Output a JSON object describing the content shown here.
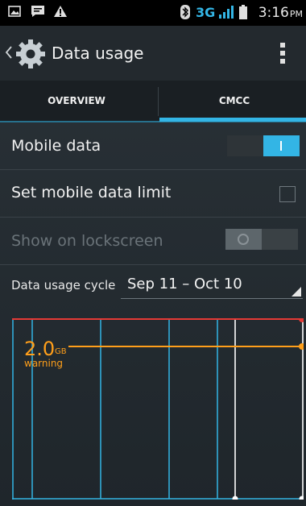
{
  "statusbar": {
    "left_icons": [
      "gallery-icon",
      "message-icon",
      "warning-icon"
    ],
    "right_icons": [
      "bluetooth-icon",
      "signal-icon",
      "battery-icon"
    ],
    "network": "3G",
    "time": "3:16",
    "ampm": "PM"
  },
  "actionbar": {
    "title": "Data usage",
    "icon": "settings-gear-icon",
    "back_icon": "back-icon",
    "overflow_icon": "overflow-menu-icon"
  },
  "tabs": [
    {
      "label": "OVERVIEW",
      "selected": false
    },
    {
      "label": "CMCC",
      "selected": true
    }
  ],
  "settings": {
    "mobile_data": {
      "label": "Mobile data",
      "on": true
    },
    "set_limit": {
      "label": "Set mobile data limit",
      "checked": false
    },
    "lockscreen": {
      "label": "Show on lockscreen",
      "on": false,
      "enabled": false
    }
  },
  "cycle": {
    "label": "Data usage cycle",
    "value": "Sep 11 – Oct 10"
  },
  "chart_data": {
    "type": "line",
    "warning": {
      "value": "2.0",
      "unit": "GB",
      "label": "warning",
      "color": "#ff9f1a"
    },
    "limit_color": "#e53935",
    "grid_color": "#33b5e5"
  },
  "colors": {
    "accent": "#33b5e5",
    "warning": "#ff9f1a",
    "limit": "#e53935"
  }
}
